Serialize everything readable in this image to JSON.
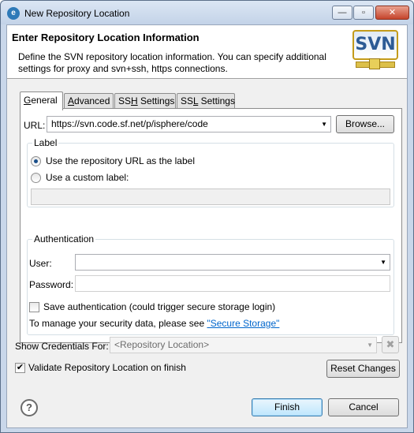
{
  "window": {
    "title": "New Repository Location",
    "minimize": "—",
    "maximize": "▫",
    "close": "✕"
  },
  "header": {
    "title": "Enter Repository Location Information",
    "description": "Define the SVN repository location information. You can specify additional settings for proxy and svn+ssh, https connections.",
    "logo_text": "SVN"
  },
  "tabs": [
    {
      "label": "General",
      "mnemonic": "G",
      "rest": "eneral",
      "active": true
    },
    {
      "label": "Advanced",
      "mnemonic": "A",
      "rest": "dvanced"
    },
    {
      "label": "SSH Settings",
      "pre": "SS",
      "mnemonic": "H",
      "rest": " Settings"
    },
    {
      "label": "SSL Settings",
      "pre": "SS",
      "mnemonic": "L",
      "rest": " Settings"
    }
  ],
  "general": {
    "url_label": "URL:",
    "url_value": "https://svn.code.sf.net/p/isphere/code",
    "browse_label": "Browse...",
    "label_group": {
      "title": "Label",
      "option_repo_url": "Use the repository URL as the label",
      "option_custom": "Use a custom label:",
      "custom_value": ""
    },
    "auth_group": {
      "title": "Authentication",
      "user_label": "User:",
      "user_value": "",
      "password_label": "Password:",
      "password_value": "",
      "save_auth_label": "Save authentication (could trigger secure storage login)",
      "secure_text": "To manage your security data, please see ",
      "secure_link": "\"Secure Storage\""
    }
  },
  "credentials": {
    "label": "Show Credentials For:",
    "value": "<Repository Location>",
    "delete_icon": "✖"
  },
  "validate": {
    "label": "Validate Repository Location on finish",
    "checked": true,
    "check_mark": "✔"
  },
  "reset_label": "Reset Changes",
  "footer": {
    "help": "?",
    "finish": "Finish",
    "cancel": "Cancel"
  },
  "icons": {
    "combo_arrow": "▼"
  }
}
